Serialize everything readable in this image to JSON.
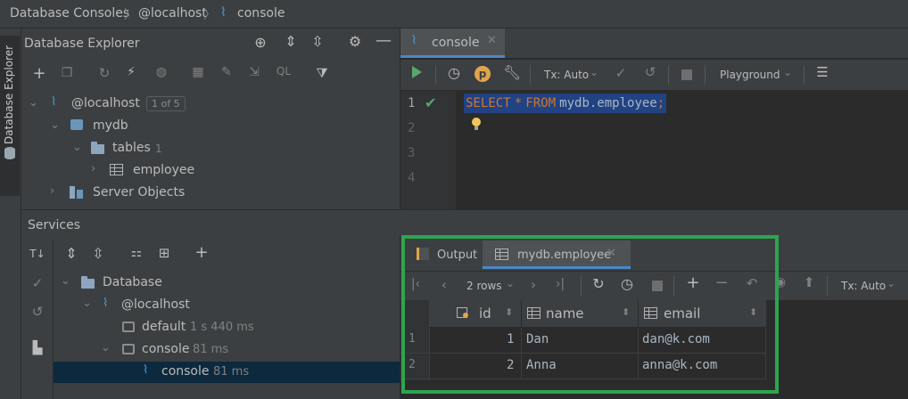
{
  "breadcrumb": [
    "Database Consoles",
    "@localhost",
    "console"
  ],
  "side_tab": "Database Explorer",
  "explorer": {
    "title": "Database Explorer",
    "host": "@localhost",
    "host_badge": "1 of 5",
    "db": "mydb",
    "tables": "tables",
    "tables_count": "1",
    "table": "employee",
    "server_objects": "Server Objects"
  },
  "editor": {
    "tab": "console",
    "tx": "Tx: Auto",
    "playground": "Playground",
    "lines": [
      "1",
      "2",
      "3",
      "4"
    ],
    "sql": {
      "kw1": "SELECT",
      "star": "*",
      "kw2": "FROM",
      "target": "mydb.employee",
      "semi": ";"
    }
  },
  "services": {
    "title": "Services",
    "tree": {
      "database": "Database",
      "host": "@localhost",
      "default": "default",
      "default_time": "1 s 440 ms",
      "console_group": "console",
      "console_group_time": "81 ms",
      "console": "console",
      "console_time": "81 ms"
    }
  },
  "results": {
    "tabs": [
      "Output",
      "mydb.employee"
    ],
    "rows_label": "2 rows",
    "tx": "Tx: Auto",
    "columns": [
      "id",
      "name",
      "email"
    ],
    "rows": [
      {
        "n": "1",
        "id": "1",
        "name": "Dan",
        "email": "dan@k.com"
      },
      {
        "n": "2",
        "id": "2",
        "name": "Anna",
        "email": "anna@k.com"
      }
    ]
  },
  "colors": {
    "highlight_box": "#2ea44f",
    "keyword": "#cc7832",
    "selection": "#214283",
    "check": "#59a869"
  }
}
